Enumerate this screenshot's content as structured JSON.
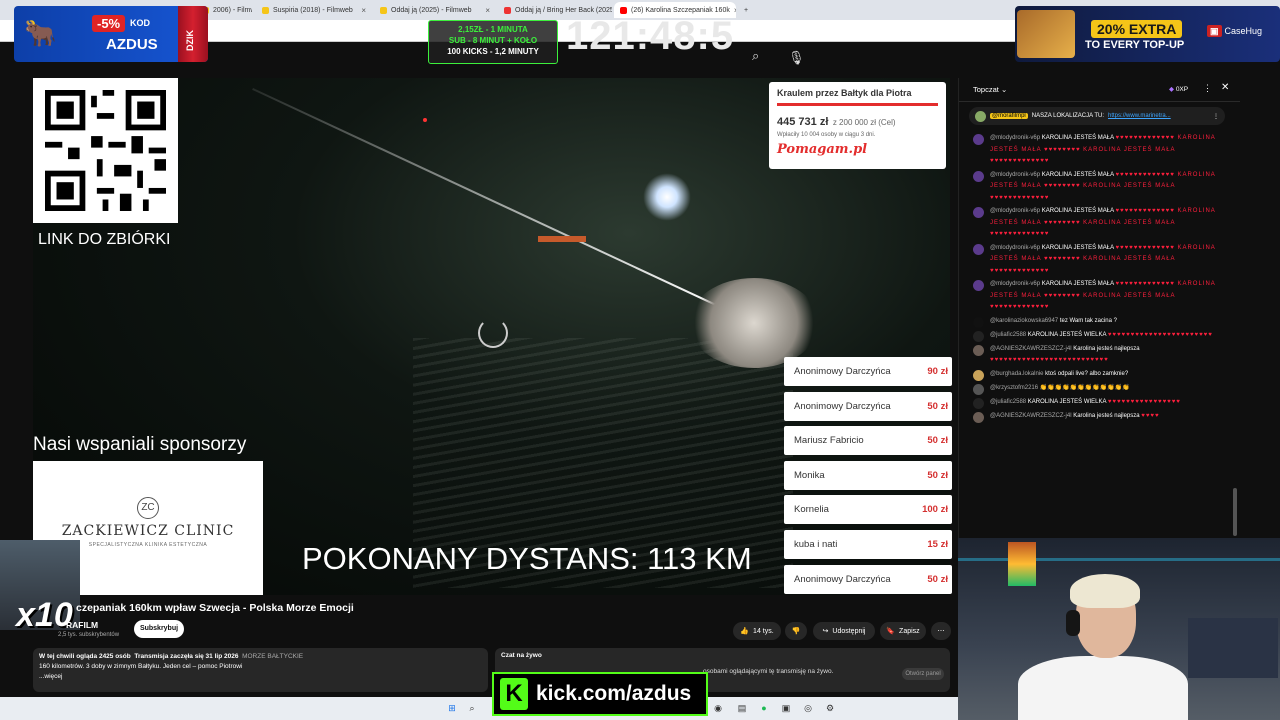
{
  "browser": {
    "tabs": [
      {
        "label": "2006) - Filmw",
        "color": "#f5c518"
      },
      {
        "label": "Suspiria (2018) - Filmweb",
        "color": "#f5c518"
      },
      {
        "label": "Oddaj ją (2025) - Filmweb",
        "color": "#f5c518"
      },
      {
        "label": "Oddaj ją / Bring Her Back (2025)",
        "color": "#e33"
      },
      {
        "label": "(26) Karolina Szczepaniak 160k",
        "color": "#f00"
      }
    ],
    "new_tab": "+"
  },
  "promo_left": {
    "discount": "-5%",
    "code_label": "KOD",
    "code": "AZDUS",
    "can_text": "DZIK"
  },
  "timer_box": {
    "line1": "2,15ZŁ - 1 MINUTA",
    "line2": "SUB - 8 MINUT + KOŁO",
    "line3": "100 KICKS - 1,2 MINUTY"
  },
  "big_timer": "121:48:5",
  "promo_right": {
    "line1": "20% EXTRA",
    "line2": "TO EVERY TOP-UP",
    "brand": "CaseHug"
  },
  "overlay": {
    "link_label": "LINK DO ZBIÓRKI",
    "sponsors_label": "Nasi wspaniali sponsorzy",
    "sponsor_name": "ZACKIEWICZ CLINIC",
    "sponsor_sub": "SPECJALISTYCZNA KLINIKA ESTETYCZNA",
    "distance": "POKONANY DYSTANS: 113 KM"
  },
  "fundraiser": {
    "title": "Kraulem przez Bałtyk dla Piotra",
    "amount": "445 731 zł",
    "goal": "z 200 000 zł (Cel)",
    "sub": "Wpłaciły 10 004 osoby w ciągu 3 dni.",
    "brand": "Pomagam.pl",
    "progress_fraction": 1.0
  },
  "donations": [
    {
      "name": "Anonimowy Darczyńca",
      "amount": "90 zł"
    },
    {
      "name": "Anonimowy Darczyńca",
      "amount": "50 zł"
    },
    {
      "name": "Mariusz Fabricio",
      "amount": "50 zł"
    },
    {
      "name": "Monika",
      "amount": "50 zł"
    },
    {
      "name": "Kornelia",
      "amount": "100 zł"
    },
    {
      "name": "kuba i nati",
      "amount": "15 zł"
    },
    {
      "name": "Anonimowy Darczyńca",
      "amount": "50 zł"
    }
  ],
  "video_info": {
    "multiplier": "x10",
    "title": "czepaniak 160km wpław Szwecja - Polska Morze Emocji",
    "channel": "RAFILM",
    "subs": "2,5 tys. subskrybentów",
    "subscribe": "Subskrybuj",
    "likes": "14 tys.",
    "share": "Udostępnij",
    "save": "Zapisz",
    "more": "⋯"
  },
  "description": {
    "line1_a": "W tej chwili ogląda 2425 osób",
    "line1_b": "Transmisja zaczęła się 31 lip 2026",
    "line1_tag": "MORZE BAŁTYCKIE",
    "line2": "160 kilometrów. 3 doby w zimnym Bałtyku. Jeden cel – pomoc Piotrowi",
    "more": "...więcej"
  },
  "live_chat_box": {
    "title": "Czat na żywo",
    "info": "osobami oglądającymi tę transmisję na żywo.",
    "open": "Otwórz panel"
  },
  "kick": {
    "logo": "K",
    "url": "kick.com/azdus"
  },
  "chat": {
    "header": "Topczat",
    "xp": "0XP",
    "pinned": {
      "name": "@morafilmpl",
      "text": "NASZA LOKALIZACJA TU:",
      "link": "https://www.marinetra..."
    },
    "messages": [
      {
        "name": "@mlodydronik-v6p",
        "text": "KAROLINA JESTEŚ MAŁA",
        "hearts": "♥♥♥♥♥♥♥♥♥♥♥♥♥ KAROLINA JESTEŚ MAŁA ♥♥♥♥♥♥♥♥ KAROLINA JESTEŚ MAŁA ♥♥♥♥♥♥♥♥♥♥♥♥♥"
      },
      {
        "name": "@mlodydronik-v6p",
        "text": "KAROLINA JESTEŚ MAŁA",
        "hearts": "♥♥♥♥♥♥♥♥♥♥♥♥♥ KAROLINA JESTEŚ MAŁA ♥♥♥♥♥♥♥♥ KAROLINA JESTEŚ MAŁA ♥♥♥♥♥♥♥♥♥♥♥♥♥"
      },
      {
        "name": "@mlodydronik-v6p",
        "text": "KAROLINA JESTEŚ MAŁA",
        "hearts": "♥♥♥♥♥♥♥♥♥♥♥♥♥ KAROLINA JESTEŚ MAŁA ♥♥♥♥♥♥♥♥ KAROLINA JESTEŚ MAŁA ♥♥♥♥♥♥♥♥♥♥♥♥♥"
      },
      {
        "name": "@mlodydronik-v6p",
        "text": "KAROLINA JESTEŚ MAŁA",
        "hearts": "♥♥♥♥♥♥♥♥♥♥♥♥♥ KAROLINA JESTEŚ MAŁA ♥♥♥♥♥♥♥♥ KAROLINA JESTEŚ MAŁA ♥♥♥♥♥♥♥♥♥♥♥♥♥"
      },
      {
        "name": "@mlodydronik-v6p",
        "text": "KAROLINA JESTEŚ MAŁA",
        "hearts": "♥♥♥♥♥♥♥♥♥♥♥♥♥ KAROLINA JESTEŚ MAŁA ♥♥♥♥♥♥♥♥ KAROLINA JESTEŚ MAŁA ♥♥♥♥♥♥♥♥♥♥♥♥♥"
      },
      {
        "name": "@karolinaziokowska6947",
        "text": "tez Wam tak zacina ?",
        "hearts": ""
      },
      {
        "name": "@juliafic2588",
        "text": "KAROLINA JESTEŚ WIELKA",
        "hearts": "♥♥♥♥♥♥♥♥♥♥♥♥♥♥♥♥♥♥♥♥♥♥♥"
      },
      {
        "name": "@AGNIESZKAWRZESZCZ-j4l",
        "text": "Karolina jesteś najlepsza",
        "hearts": "♥♥♥♥♥♥♥♥♥♥♥♥♥♥♥♥♥♥♥♥♥♥♥♥♥♥"
      },
      {
        "name": "@burghada.lokalnie",
        "text": "ktoś odpali live? albo zamknie?",
        "hearts": ""
      },
      {
        "name": "@krzysztofm2216",
        "text": "👏👏👏👏👏👏👏👏👏👏👏👏",
        "hearts": ""
      },
      {
        "name": "@juliafic2588",
        "text": "KAROLINA JESTEŚ WIELKA",
        "hearts": "♥♥♥♥♥♥♥♥♥♥♥♥♥♥♥♥"
      },
      {
        "name": "@AGNIESZKAWRZESZCZ-j4l",
        "text": "Karolina jesteś najlepsza",
        "hearts": "♥♥♥♥"
      }
    ]
  },
  "colors": {
    "accent_green": "#53fc18",
    "heart_red": "#ff1f3d",
    "fund_red": "#e32d2d"
  }
}
